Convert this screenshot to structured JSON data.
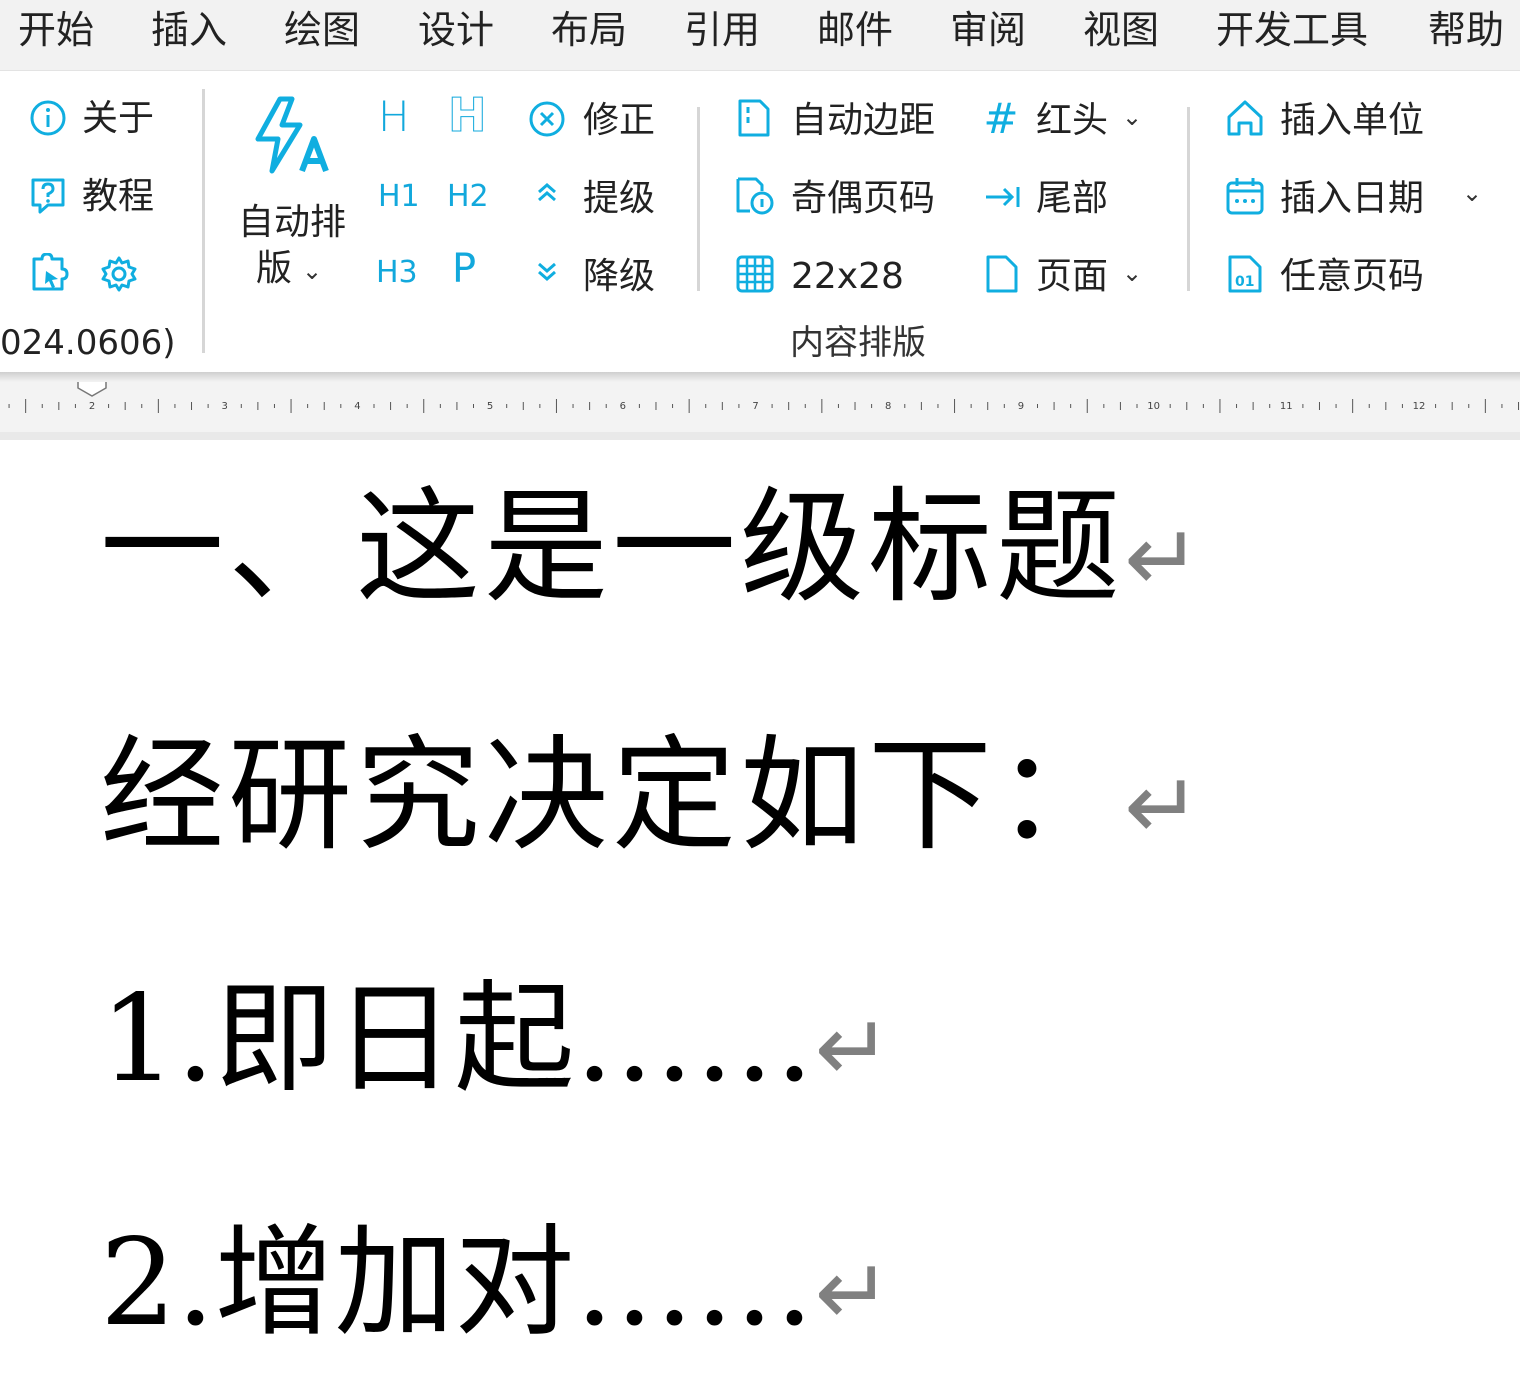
{
  "menu": {
    "tabs": [
      "开始",
      "插入",
      "绘图",
      "设计",
      "布局",
      "引用",
      "邮件",
      "审阅",
      "视图",
      "开发工具",
      "帮助"
    ]
  },
  "ribbon": {
    "about_label": "关于",
    "tutorial_label": "教程",
    "version_text": "024.0606)",
    "auto_layout_label_1": "自动排",
    "auto_layout_label_2": "版",
    "heading_buttons": [
      "H",
      "H",
      "H1",
      "H2",
      "H3",
      "P"
    ],
    "fix_label": "修正",
    "promote_label": "提级",
    "demote_label": "降级",
    "auto_margin_label": "自动边距",
    "odd_even_page_label": "奇偶页码",
    "grid_label": "22x28",
    "red_header_label": "红头",
    "tail_label": "尾部",
    "page_label": "页面",
    "insert_unit_label": "插入单位",
    "insert_date_label": "插入日期",
    "any_page_label": "任意页码",
    "group_content_layout": "内容排版"
  },
  "ruler": {
    "numbers": [
      "2",
      "3",
      "4",
      "5",
      "6",
      "7",
      "8",
      "9",
      "10",
      "11",
      "12"
    ]
  },
  "document": {
    "paragraphs": [
      {
        "text": "一、这是一级标题",
        "mark": "↵"
      },
      {
        "text": "经研究决定如下：",
        "mark": "↵"
      },
      {
        "text": "1.即日起……",
        "mark": "↵"
      },
      {
        "text": "2.增加对……",
        "mark": "↵"
      }
    ]
  },
  "colors": {
    "accent": "#10aee0",
    "menu_bg": "#f2f2f2",
    "ribbon_bg": "#ffffff",
    "para_mark": "#808080"
  }
}
